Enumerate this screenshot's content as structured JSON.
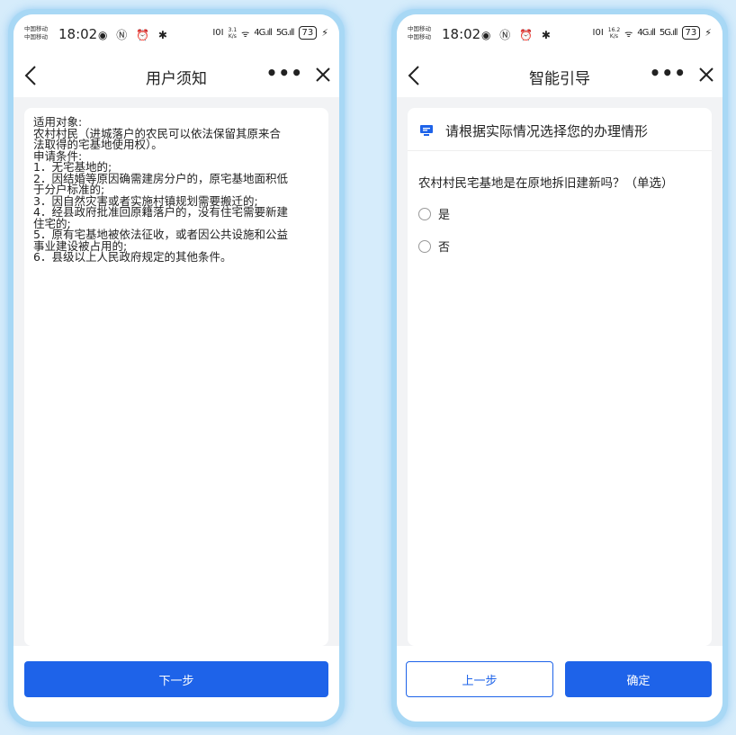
{
  "status_bar": {
    "carrier_1": "中国移动",
    "carrier_2": "中国移动",
    "time": "18:02",
    "left_icons": "◉ Ⓝ ⏰ ✱",
    "vibrate": "I0I",
    "left_speed_value": "3.1",
    "right_speed_value": "16.2",
    "speed_unit": "K/s",
    "wifi": "ᯤ",
    "signal_1": "4G.ıll",
    "signal_2": "5G.ıll",
    "battery": "73",
    "charging": "⚡"
  },
  "left_screen": {
    "title": "用户须知",
    "more": "•••",
    "notice_lines": [
      "适用对象:",
      "农村村民（进城落户的农民可以依法保留其原来合",
      "法取得的宅基地使用权）。",
      "申请条件:",
      "1．无宅基地的;",
      "2．因结婚等原因确需建房分户的，原宅基地面积低",
      "于分户标准的;",
      "3．因自然灾害或者实施村镇规划需要搬迁的;",
      "4．经县政府批准回原籍落户的，没有住宅需要新建",
      "住宅的;",
      "5．原有宅基地被依法征收，或者因公共设施和公益",
      "事业建设被占用的;",
      "6．县级以上人民政府规定的其他条件。"
    ],
    "next_button": "下一步"
  },
  "right_screen": {
    "title": "智能引导",
    "more": "•••",
    "prompt": "请根据实际情况选择您的办理情形",
    "question": "农村村民宅基地是在原地拆旧建新吗？（单选）",
    "options": [
      "是",
      "否"
    ],
    "prev_button": "上一步",
    "confirm_button": "确定"
  },
  "colors": {
    "primary": "#1e63e9",
    "page_bg": "#f2f3f5",
    "frame": "#a8d8f5"
  }
}
